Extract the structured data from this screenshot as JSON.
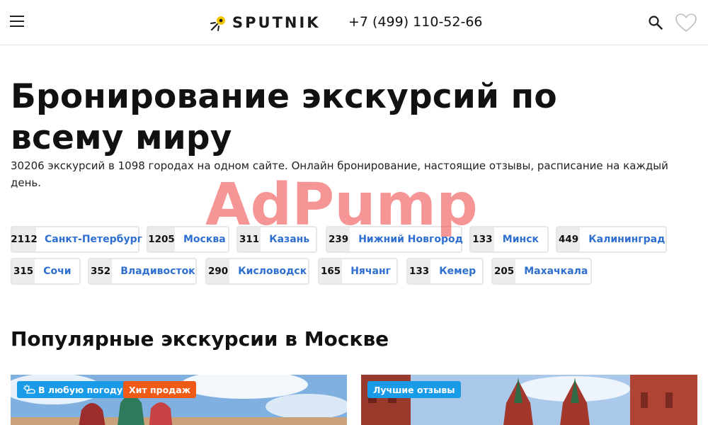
{
  "header": {
    "logo_text": "SPUTNIK",
    "phone": "+7 (499) 110-52-66",
    "icons": {
      "menu": "burger-menu-icon",
      "search": "search-icon",
      "favorites": "heart-icon"
    }
  },
  "hero": {
    "title": "Бронирование экскурсий по всему миру",
    "subtitle": "30206 экскурсий в 1098 городах на одном сайте. Онлайн бронирование, настоящие отзывы, расписание на каждый день."
  },
  "cities": [
    {
      "count": "2112",
      "name": "Санкт-Петербург"
    },
    {
      "count": "1205",
      "name": "Москва"
    },
    {
      "count": "311",
      "name": "Казань"
    },
    {
      "count": "239",
      "name": "Нижний Новгород"
    },
    {
      "count": "133",
      "name": "Минск"
    },
    {
      "count": "449",
      "name": "Калининград"
    },
    {
      "count": "315",
      "name": "Сочи"
    },
    {
      "count": "352",
      "name": "Владивосток"
    },
    {
      "count": "290",
      "name": "Кисловодск"
    },
    {
      "count": "165",
      "name": "Нячанг"
    },
    {
      "count": "133",
      "name": "Кемер"
    },
    {
      "count": "205",
      "name": "Махачкала"
    }
  ],
  "popular": {
    "title": "Популярные экскурсии в Москве",
    "cards": [
      {
        "badges": [
          "В любую погоду",
          "Хит продаж"
        ]
      },
      {
        "badges": [
          "Лучшие отзывы"
        ]
      }
    ]
  },
  "watermark_text": "AdPump",
  "colors": {
    "link": "#2f6fd0",
    "badge_blue": "#1a9be8",
    "badge_orange": "#f05a17",
    "watermark": "#f04e4e"
  }
}
